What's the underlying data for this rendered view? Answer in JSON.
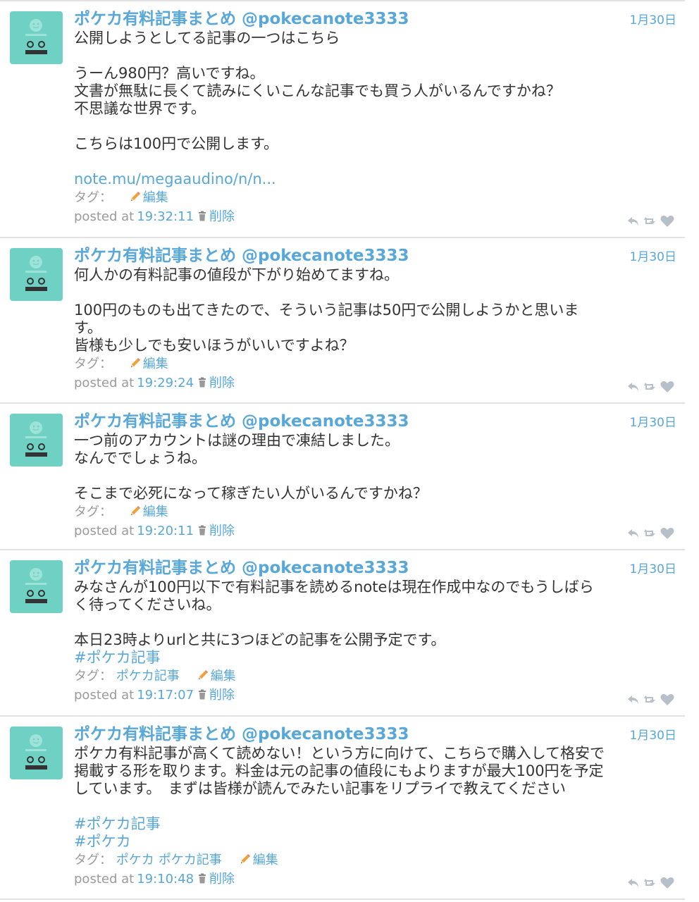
{
  "tweets": [
    {
      "author": "ポケカ有料記事まとめ @pokecanote3333",
      "date": "1月30日",
      "lines": [
        {
          "text": "公開しようとしてる記事の一つはこちら",
          "kind": "text"
        },
        {
          "text": "",
          "kind": "text"
        },
        {
          "text": "うーん980円？高いですね。",
          "kind": "text"
        },
        {
          "text": "文書が無駄に長くて読みにくいこんな記事でも買う人がいるんですかね？",
          "kind": "text"
        },
        {
          "text": "不思議な世界です。",
          "kind": "text"
        },
        {
          "text": "",
          "kind": "text"
        },
        {
          "text": "こちらは100円で公開します。",
          "kind": "text"
        },
        {
          "text": "",
          "kind": "text"
        },
        {
          "text": "note.mu/megaaudino/n/n...",
          "kind": "link"
        }
      ],
      "tag_label": "タグ：",
      "tags": [],
      "edit_label": "編集",
      "posted_label": "posted at",
      "time": "19:32:11",
      "delete_label": "削除"
    },
    {
      "author": "ポケカ有料記事まとめ @pokecanote3333",
      "date": "1月30日",
      "lines": [
        {
          "text": "何人かの有料記事の値段が下がり始めてますね。",
          "kind": "text"
        },
        {
          "text": "",
          "kind": "text"
        },
        {
          "text": "100円のものも出てきたので、そういう記事は50円で公開しようかと思いま",
          "kind": "text"
        },
        {
          "text": "す。",
          "kind": "text"
        },
        {
          "text": "皆様も少しでも安いほうがいいですよね？",
          "kind": "text"
        }
      ],
      "tag_label": "タグ：",
      "tags": [],
      "edit_label": "編集",
      "posted_label": "posted at",
      "time": "19:29:24",
      "delete_label": "削除"
    },
    {
      "author": "ポケカ有料記事まとめ @pokecanote3333",
      "date": "1月30日",
      "lines": [
        {
          "text": "一つ前のアカウントは謎の理由で凍結しました。",
          "kind": "text"
        },
        {
          "text": "なんででしょうね。",
          "kind": "text"
        },
        {
          "text": "",
          "kind": "text"
        },
        {
          "text": "そこまで必死になって稼ぎたい人がいるんですかね？",
          "kind": "text"
        }
      ],
      "tag_label": "タグ：",
      "tags": [],
      "edit_label": "編集",
      "posted_label": "posted at",
      "time": "19:20:11",
      "delete_label": "削除"
    },
    {
      "author": "ポケカ有料記事まとめ @pokecanote3333",
      "date": "1月30日",
      "lines": [
        {
          "text": "みなさんが100円以下で有料記事を読めるnoteは現在作成中なのでもうしばら",
          "kind": "text"
        },
        {
          "text": "く待ってくださいね。",
          "kind": "text"
        },
        {
          "text": "",
          "kind": "text"
        },
        {
          "text": "本日23時よりurlと共に3つほどの記事を公開予定です。",
          "kind": "text"
        },
        {
          "text": "#ポケカ記事",
          "kind": "hashtag"
        }
      ],
      "tag_label": "タグ：",
      "tags": [
        "ポケカ記事"
      ],
      "edit_label": "編集",
      "posted_label": "posted at",
      "time": "19:17:07",
      "delete_label": "削除"
    },
    {
      "author": "ポケカ有料記事まとめ @pokecanote3333",
      "date": "1月30日",
      "lines": [
        {
          "text": "ポケカ有料記事が高くて読めない！という方に向けて、こちらで購入して格安で",
          "kind": "text"
        },
        {
          "text": "掲載する形を取ります。料金は元の記事の値段にもよりますが最大100円を予定",
          "kind": "text"
        },
        {
          "text": "しています。　まずは皆様が読んでみたい記事をリプライで教えてください",
          "kind": "text"
        },
        {
          "text": "",
          "kind": "text"
        },
        {
          "text": "#ポケカ記事",
          "kind": "hashtag"
        },
        {
          "text": "#ポケカ",
          "kind": "hashtag"
        }
      ],
      "tag_label": "タグ：",
      "tags": [
        "ポケカ",
        "ポケカ記事"
      ],
      "edit_label": "編集",
      "posted_label": "posted at",
      "time": "19:10:48",
      "delete_label": "削除"
    }
  ]
}
